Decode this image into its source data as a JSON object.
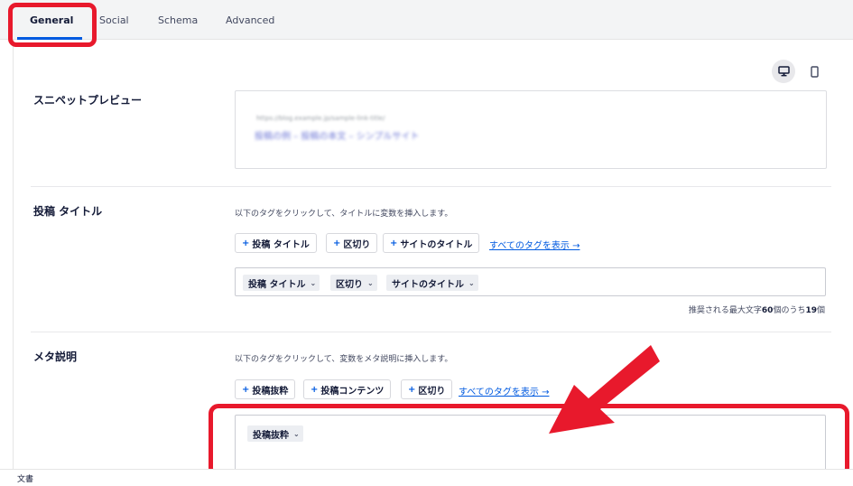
{
  "tabs": [
    {
      "label": "General"
    },
    {
      "label": "Social"
    },
    {
      "label": "Schema"
    },
    {
      "label": "Advanced"
    }
  ],
  "device_preview": {
    "desktop_icon": "desktop-icon",
    "mobile_icon": "mobile-icon",
    "active": "desktop"
  },
  "snippet": {
    "label": "スニペットプレビュー",
    "url_blurred": "https://blog.example.jp/sample-link-title/",
    "title_blurred": "投稿の例 – 投稿の本文 – シンプルサイト"
  },
  "post_title": {
    "label": "投稿 タイトル",
    "description": "以下のタグをクリックして、タイトルに変数を挿入します。",
    "tag_buttons": [
      "投稿 タイトル",
      "区切り",
      "サイトのタイトル"
    ],
    "show_all": "すべてのタグを表示 →",
    "chips": [
      "投稿 タイトル",
      "区切り",
      "サイトのタイトル"
    ],
    "counter_prefix": "推奨される最大文字",
    "counter_max": "60",
    "counter_mid": "個のうち",
    "counter_current": "19",
    "counter_suffix": "個"
  },
  "meta_description": {
    "label": "メタ説明",
    "description": "以下のタグをクリックして、変数をメタ説明に挿入します。",
    "tag_buttons": [
      "投稿抜粋",
      "投稿コンテンツ",
      "区切り"
    ],
    "show_all": "すべてのタグを表示 →",
    "chips": [
      "投稿抜粋"
    ]
  },
  "footer": {
    "text": "文書"
  },
  "colors": {
    "accent": "#005ae0",
    "annotation": "#e8192c",
    "text": "#141b38"
  }
}
